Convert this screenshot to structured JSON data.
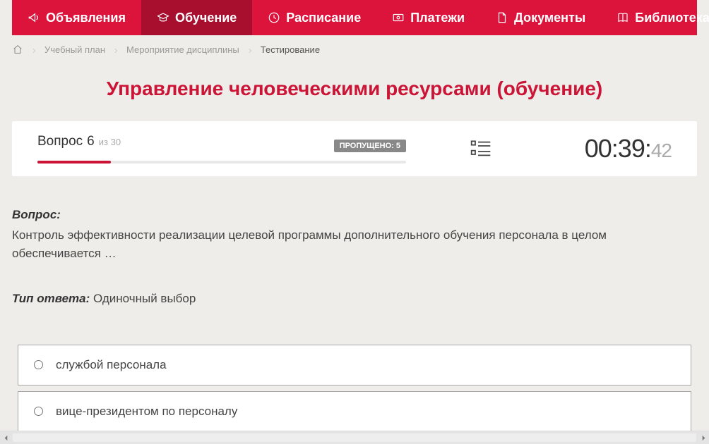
{
  "nav": {
    "items": [
      {
        "label": "Объявления",
        "icon": "megaphone"
      },
      {
        "label": "Обучение",
        "icon": "graduation",
        "active": true
      },
      {
        "label": "Расписание",
        "icon": "clock"
      },
      {
        "label": "Платежи",
        "icon": "payment"
      },
      {
        "label": "Документы",
        "icon": "document"
      },
      {
        "label": "Библиотека",
        "icon": "book",
        "dropdown": true
      }
    ]
  },
  "breadcrumb": {
    "items": [
      {
        "label": "Учебный план"
      },
      {
        "label": "Мероприятие дисциплины"
      }
    ],
    "current": "Тестирование"
  },
  "title": "Управление человеческими ресурсами (обучение)",
  "status": {
    "question_word": "Вопрос",
    "question_num": "6",
    "total_prefix": "из",
    "total_num": "30",
    "skipped_label": "ПРОПУЩЕНО: 5",
    "progress_percent": 20,
    "timer_main": "00:39:",
    "timer_sub": "42"
  },
  "question": {
    "label": "Вопрос:",
    "text": "Контроль эффективности реализации целевой программы дополнительного обучения персонала в целом обеспечивается …",
    "answer_type_label": "Тип ответа:",
    "answer_type_value": "Одиночный выбор"
  },
  "answers": [
    {
      "text": "службой персонала"
    },
    {
      "text": "вице-президентом по персоналу"
    }
  ]
}
